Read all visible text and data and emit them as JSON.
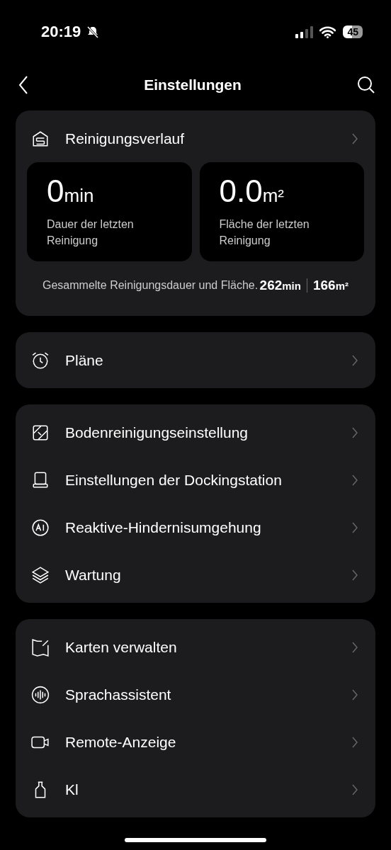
{
  "status_bar": {
    "time": "20:19",
    "battery": "45"
  },
  "header": {
    "title": "Einstellungen"
  },
  "history": {
    "label": "Reinigungsverlauf",
    "stats": [
      {
        "value": "0",
        "unit": "min",
        "caption": "Dauer der letzten Reinigung"
      },
      {
        "value": "0.0",
        "unit": "m²",
        "caption": "Fläche der letzten Reinigung"
      }
    ],
    "total_caption": "Gesammelte Reinigungsdauer und Fläche.",
    "total_time": "262",
    "total_time_unit": "min",
    "total_area": "166",
    "total_area_unit": "m²"
  },
  "groups": [
    [
      {
        "kind": "clock",
        "label": "Pläne"
      }
    ],
    [
      {
        "kind": "floor",
        "label": "Bodenreinigungseinstellung"
      },
      {
        "kind": "dock",
        "label": "Einstellungen der Dockingstation"
      },
      {
        "kind": "ai",
        "label": "Reaktive-Hindernisumgehung"
      },
      {
        "kind": "layers",
        "label": "Wartung"
      }
    ],
    [
      {
        "kind": "map",
        "label": "Karten verwalten"
      },
      {
        "kind": "voice",
        "label": "Sprachassistent"
      },
      {
        "kind": "camera",
        "label": "Remote-Anzeige"
      },
      {
        "kind": "bottle",
        "label": "Kl"
      }
    ]
  ]
}
